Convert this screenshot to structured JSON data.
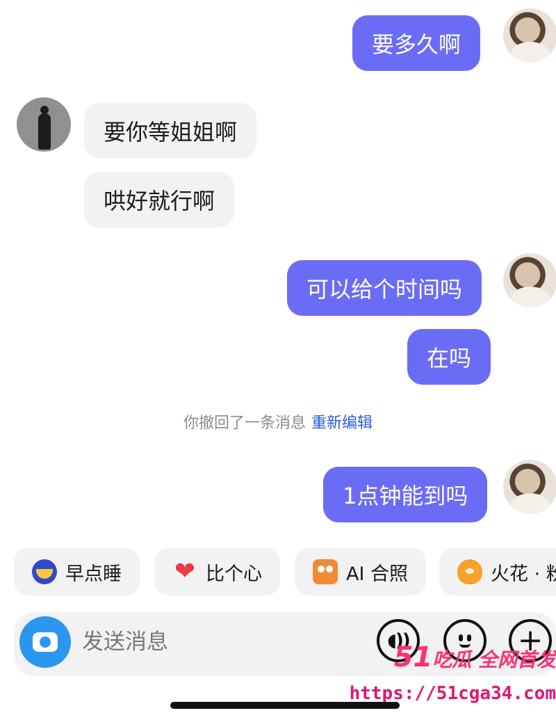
{
  "messages": [
    {
      "side": "out",
      "text": "要多久啊"
    },
    {
      "side": "in",
      "text": "要你等姐姐啊"
    },
    {
      "side": "in",
      "text": "哄好就行啊"
    },
    {
      "side": "out",
      "text": "可以给个时间吗"
    },
    {
      "side": "out",
      "text": "在吗"
    },
    {
      "side": "out",
      "text": "1点钟能到吗"
    }
  ],
  "system_notice": {
    "text": "你撤回了一条消息",
    "action_label": "重新编辑"
  },
  "quick_actions": [
    {
      "label": "早点睡",
      "icon": "moon-icon"
    },
    {
      "label": "比个心",
      "icon": "heart-icon"
    },
    {
      "label": "AI 合照",
      "icon": "photo-icon"
    },
    {
      "label": "火花 · 粉",
      "icon": "spark-icon"
    }
  ],
  "composer": {
    "placeholder": "发送消息",
    "camera_icon": "camera-icon",
    "voice_icon": "voice-icon",
    "emoji_icon": "emoji-icon",
    "plus_icon": "plus-icon"
  },
  "watermark": {
    "badge_number": "51",
    "badge_text": "吃瓜 全网首发",
    "url": "https://51cga34.com"
  },
  "colors": {
    "outgoing_bubble": "#6b6cf6",
    "incoming_bubble": "#f2f2f3",
    "link": "#2b5fd6",
    "camera_button": "#2b96ef",
    "watermark": "#ff2f73"
  }
}
